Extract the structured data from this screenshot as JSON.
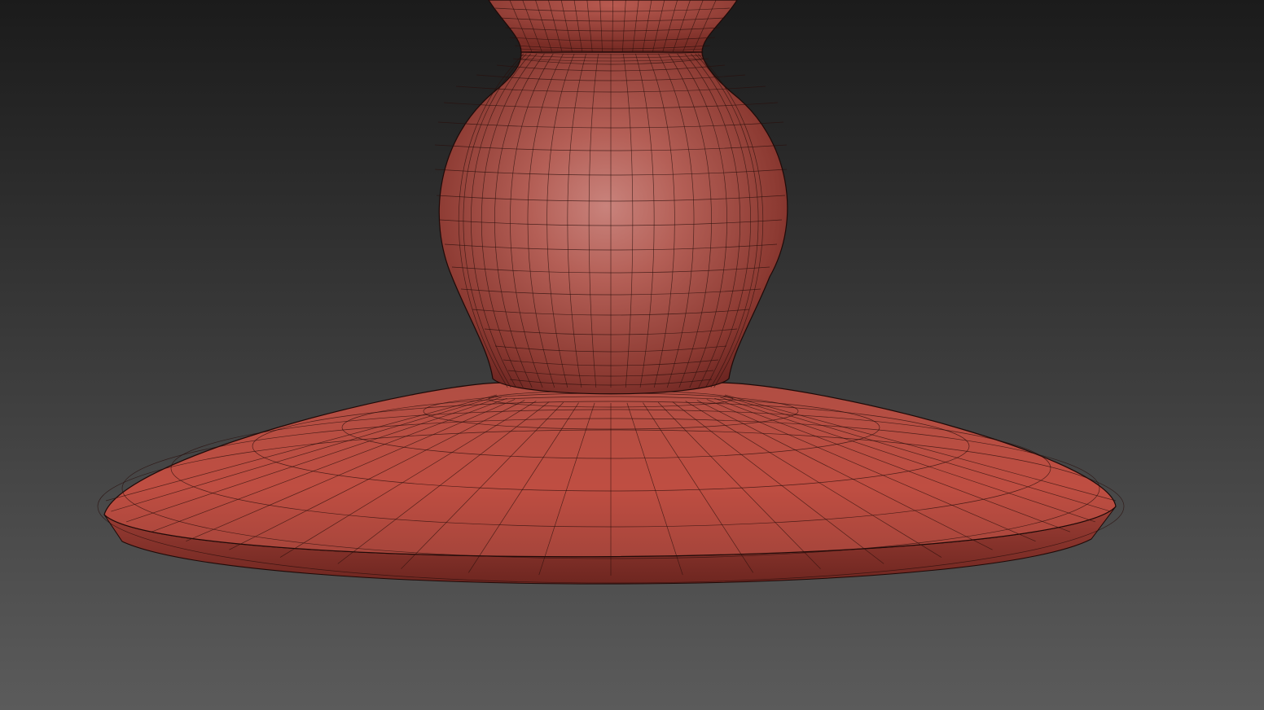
{
  "viewport": {
    "shading": "smooth-with-wireframe-edges",
    "background": {
      "top": "#1b1b1b",
      "bottom": "#5b5b5b"
    }
  },
  "object": {
    "description_name": "turned-pedestal-base",
    "colors": {
      "base": "#b84a3f",
      "highlight": "#c9837c",
      "shadow": "#6a2420",
      "edge": "#1f0a08",
      "wire": "#2a0f0c"
    },
    "wireframe_visible": true
  }
}
